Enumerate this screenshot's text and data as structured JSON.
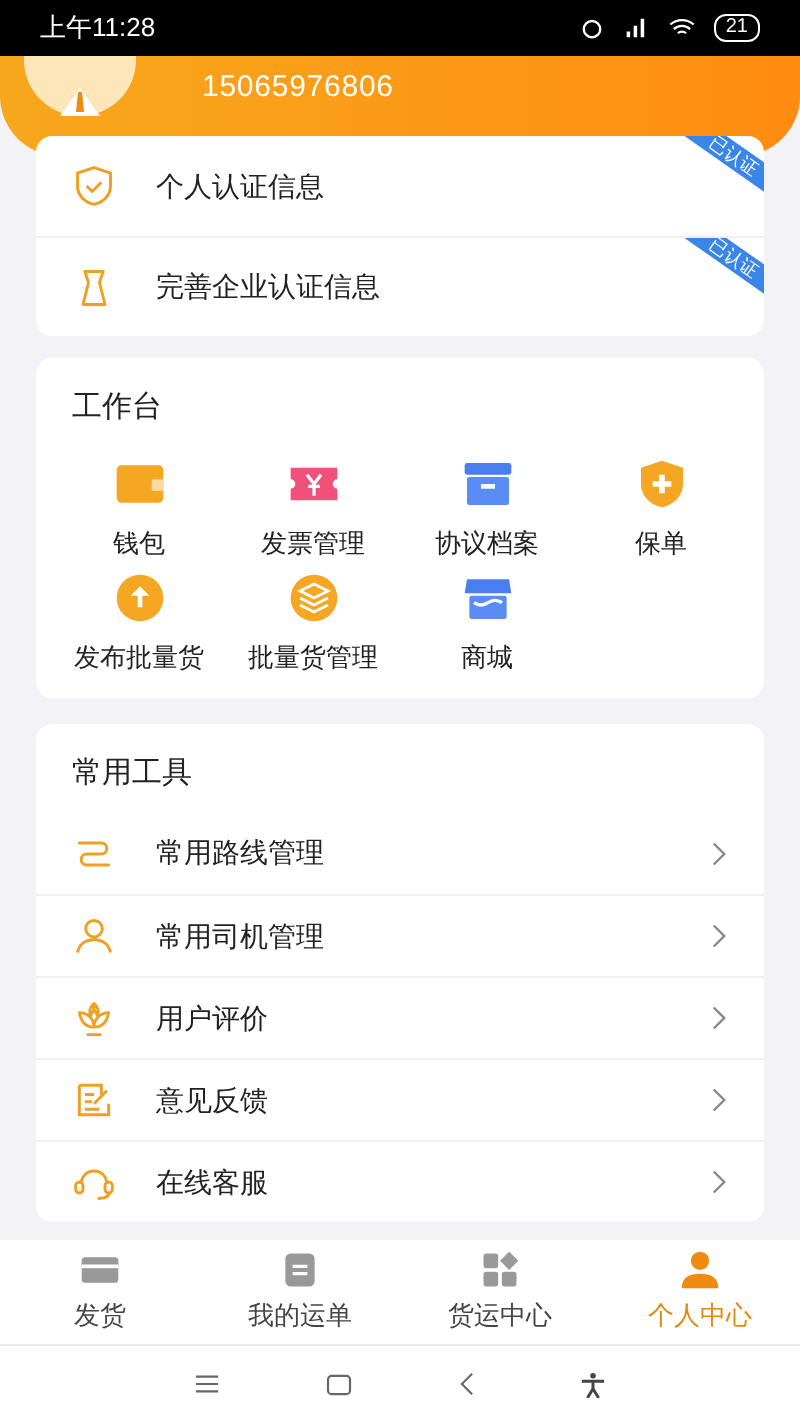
{
  "status_bar": {
    "time": "上午11:28",
    "battery": "21"
  },
  "profile": {
    "phone": "15065976806"
  },
  "certifications": [
    {
      "label": "个人认证信息",
      "verified": true,
      "badge": "已认证"
    },
    {
      "label": "完善企业认证信息",
      "verified": true,
      "badge": "已认证"
    }
  ],
  "workbench": {
    "title": "工作台",
    "items": [
      {
        "label": "钱包"
      },
      {
        "label": "发票管理"
      },
      {
        "label": "协议档案"
      },
      {
        "label": "保单"
      },
      {
        "label": "发布批量货"
      },
      {
        "label": "批量货管理"
      },
      {
        "label": "商城"
      }
    ]
  },
  "tools": {
    "title": "常用工具",
    "items": [
      {
        "label": "常用路线管理"
      },
      {
        "label": "常用司机管理"
      },
      {
        "label": "用户评价"
      },
      {
        "label": "意见反馈"
      },
      {
        "label": "在线客服"
      }
    ]
  },
  "tab_bar": [
    {
      "label": "发货",
      "selected": false
    },
    {
      "label": "我的运单",
      "selected": false
    },
    {
      "label": "货运中心",
      "selected": false
    },
    {
      "label": "个人中心",
      "selected": true
    }
  ]
}
